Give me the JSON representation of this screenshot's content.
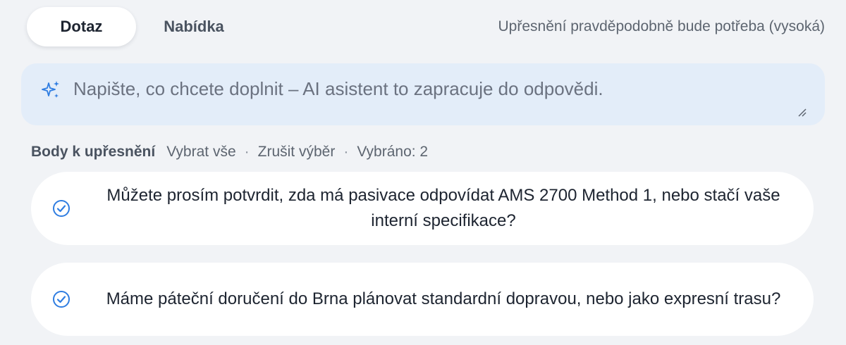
{
  "header": {
    "tabs": [
      {
        "label": "Dotaz",
        "active": true
      },
      {
        "label": "Nabídka",
        "active": false
      }
    ],
    "status": "Upřesnění pravděpodobně bude potřeba (vysoká)"
  },
  "prompt": {
    "placeholder": "Napište, co chcete doplnit – AI asistent to zapracuje do odpovědi.",
    "value": "",
    "icon": "sparkle-icon"
  },
  "clarifications": {
    "title": "Body k upřesnění",
    "select_all": "Vybrat vše",
    "separator": "·",
    "deselect": "Zrušit výběr",
    "selected_count": "Vybráno: 2",
    "items": [
      {
        "text": "Můžete prosím potvrdit, zda má pasivace odpovídat AMS 2700 Method 1, nebo stačí vaše interní specifikace?",
        "checked": true
      },
      {
        "text": "Máme páteční doručení do Brna plánovat standardní dopravou, nebo jako expresní trasu?",
        "checked": true
      }
    ]
  },
  "colors": {
    "accent": "#2f7de1",
    "background": "#f1f3f6",
    "prompt_background": "#e3edf9",
    "card": "#ffffff"
  }
}
